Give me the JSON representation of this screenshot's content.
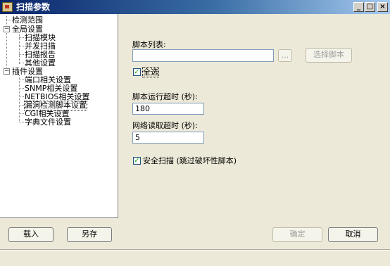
{
  "window": {
    "title": "扫描参数",
    "min_icon": "minimize-icon",
    "max_icon": "maximize-icon",
    "close_icon": "close-icon"
  },
  "tree": {
    "items": [
      {
        "label": "检测范围"
      },
      {
        "label": "全局设置"
      },
      {
        "label": "扫描模块"
      },
      {
        "label": "并发扫描"
      },
      {
        "label": "扫描报告"
      },
      {
        "label": "其他设置"
      },
      {
        "label": "插件设置"
      },
      {
        "label": "端口相关设置"
      },
      {
        "label": "SNMP相关设置"
      },
      {
        "label": "NETBIOS相关设置"
      },
      {
        "label": "漏洞检测脚本设置"
      },
      {
        "label": "CGI相关设置"
      },
      {
        "label": "字典文件设置"
      }
    ],
    "expander_symbol": "−"
  },
  "panel": {
    "script_list_label": "脚本列表:",
    "script_list_value": "",
    "browse_label": "...",
    "select_script_label": "选择脚本",
    "select_all_label": "全选",
    "select_all_checked": true,
    "timeout_label": "脚本运行超时 (秒):",
    "timeout_value": "180",
    "net_timeout_label": "网络读取超时 (秒):",
    "net_timeout_value": "5",
    "safe_scan_label": "安全扫描 (跳过破坏性脚本)",
    "safe_scan_checked": true,
    "check_mark": "✓"
  },
  "footer": {
    "load_label": "载入",
    "save_as_label": "另存",
    "ok_label": "确定",
    "cancel_label": "取消"
  }
}
